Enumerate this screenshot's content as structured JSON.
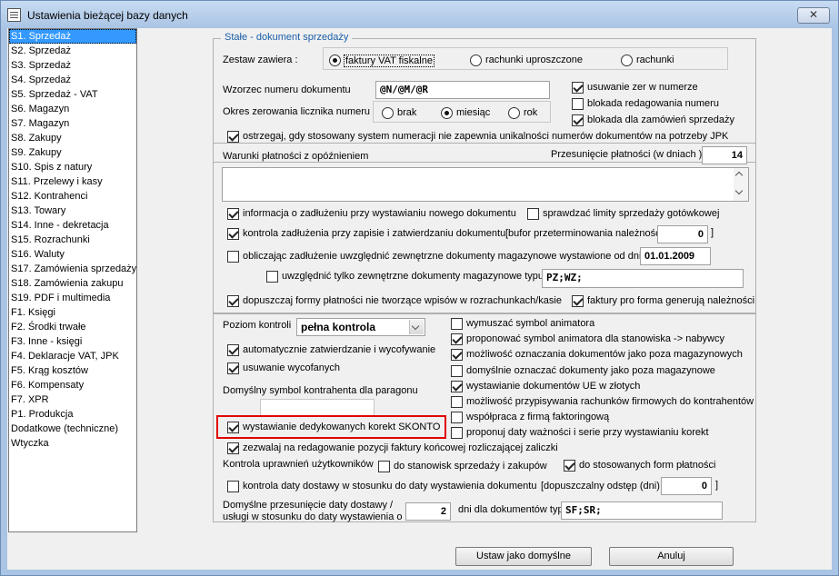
{
  "window": {
    "title": "Ustawienia bieżącej bazy danych",
    "close_glyph": "✕",
    "close_label": "close-icon"
  },
  "nav": {
    "items": [
      "S1. Sprzedaż",
      "S2. Sprzedaż",
      "S3. Sprzedaż",
      "S4. Sprzedaż",
      "S5. Sprzedaż - VAT",
      "S6. Magazyn",
      "S7. Magazyn",
      "S8. Zakupy",
      "S9. Zakupy",
      "S10. Spis z natury",
      "S11. Przelewy i kasy",
      "S12. Kontrahenci",
      "S13. Towary",
      "S14. Inne - dekretacja",
      "S15. Rozrachunki",
      "S16. Waluty",
      "S17. Zamówienia sprzedaży",
      "S18. Zamówienia zakupu",
      "S19. PDF i multimedia",
      "F1. Księgi",
      "F2. Środki trwałe",
      "F3. Inne - księgi",
      "F4. Deklaracje VAT, JPK",
      "F5. Krąg kosztów",
      "F6. Kompensaty",
      "F7. XPR",
      "P1. Produkcja",
      "Dodatkowe (techniczne)",
      "Wtyczka"
    ],
    "selected_index": 0
  },
  "group1": {
    "legend": "Stałe - dokument sprzedaży",
    "zestaw_label": "Zestaw zawiera :",
    "zestaw_options": [
      "faktury VAT fiskalne",
      "rachunki uproszczone",
      "rachunki"
    ],
    "zestaw_selected": 0,
    "wzorzec_label": "Wzorzec numeru dokumentu",
    "wzorzec_value": "@N/@M/@R",
    "okres_label": "Okres zerowania licznika numeru",
    "okres_options": [
      "brak",
      "miesiąc",
      "rok"
    ],
    "okres_selected": 1,
    "right_checks": [
      {
        "label": "usuwanie zer w numerze",
        "checked": true
      },
      {
        "label": "blokada redagowania numeru",
        "checked": false
      },
      {
        "label": "blokada dla zamówień sprzedaży",
        "checked": true
      }
    ],
    "ostrzegaj_label": "ostrzegaj, gdy stosowany system numeracji nie zapewnia unikalności numerów dokumentów na potrzeby JPK",
    "ostrzegaj_checked": true
  },
  "group2": {
    "warunki_label": "Warunki płatności z opóźnieniem",
    "przesuniecie_label": "Przesunięcie płatności (w dniach )",
    "przesuniecie_value": "14",
    "info_label": "informacja o zadłużeniu przy wystawianiu nowego dokumentu",
    "info_checked": true,
    "limity_label": "sprawdzać limity sprzedaży gotówkowej",
    "limity_checked": false,
    "kontrola_label": "kontrola zadłużenia przy zapisie i zatwierdzaniu dokumentu",
    "kontrola_checked": true,
    "bufor_label": "[bufor przeterminowania należności (dni)",
    "bufor_value": "0",
    "bufor_close": "]",
    "obliczajac_label": "obliczając zadłużenie uwzględnić zewnętrzne dokumenty magazynowe wystawione od dnia",
    "obliczajac_checked": false,
    "obliczajac_date": "01.01.2009",
    "uwzglednic_label": "uwzględnić tylko zewnętrzne dokumenty magazynowe typu :",
    "uwzglednic_checked": false,
    "uwzglednic_value": "PZ;WZ;",
    "dopuszczaj_label": "dopuszczaj formy płatności nie tworzące wpisów w rozrachunkach/kasie",
    "dopuszczaj_checked": true,
    "proforma_label": "faktury pro forma generują należności",
    "proforma_checked": true
  },
  "group3": {
    "poziom_label": "Poziom kontroli",
    "poziom_value": "pełna kontrola",
    "left_checks": [
      {
        "label": "automatycznie zatwierdzanie i wycofywanie",
        "checked": true
      },
      {
        "label": "usuwanie wycofanych",
        "checked": true
      }
    ],
    "symbol_label": "Domyślny symbol kontrahenta dla paragonu",
    "symbol_value": "",
    "skonto_label": "wystawianie dedykowanych korekt SKONTO",
    "skonto_checked": true,
    "right_checks": [
      {
        "label": "wymuszać symbol animatora",
        "checked": false
      },
      {
        "label": "proponować symbol animatora dla stanowiska -> nabywcy",
        "checked": true
      },
      {
        "label": "możliwość oznaczania dokumentów jako poza magazynowych",
        "checked": true
      },
      {
        "label": "domyślnie oznaczać dokumenty jako poza magazynowe",
        "checked": false
      },
      {
        "label": "wystawianie dokumentów UE w złotych",
        "checked": true
      },
      {
        "label": "możliwość przypisywania rachunków firmowych do kontrahentów",
        "checked": false
      },
      {
        "label": "współpraca z firmą faktoringową",
        "checked": false
      },
      {
        "label": "proponuj daty ważności i serie przy wystawianiu korekt",
        "checked": false
      }
    ],
    "zezwalaj_label": "zezwalaj na redagowanie pozycji faktury końcowej rozliczającej zaliczki",
    "zezwalaj_checked": true,
    "uprawnien_label": "Kontrola uprawnień użytkowników",
    "stanowisk_label": "do stanowisk sprzedaży i zakupów",
    "stanowisk_checked": false,
    "form_label": "do stosowanych form płatności",
    "form_checked": true,
    "daty_label": "kontrola daty dostawy w stosunku do daty wystawienia dokumentu",
    "daty_checked": false,
    "odstep_label": "[dopuszczalny odstęp (dni)",
    "odstep_value": "0",
    "odstep_close": "]",
    "przes_line1": "Domyślne przesunięcie daty dostawy /",
    "przes_line2": "usługi w stosunku do daty wystawienia o",
    "przes_value": "2",
    "dni_label": "dni dla dokumentów typu",
    "dni_value": "SF;SR;"
  },
  "buttons": {
    "default_label": "Ustaw jako domyślne",
    "cancel_label": "Anuluj"
  }
}
